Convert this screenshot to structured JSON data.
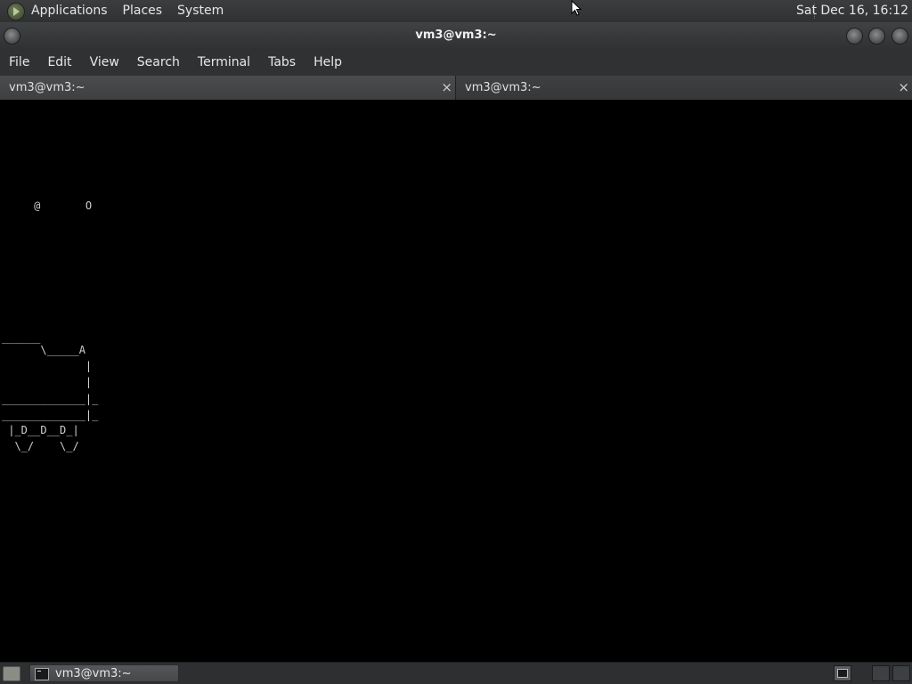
{
  "top_panel": {
    "menus": [
      "Applications",
      "Places",
      "System"
    ],
    "clock": "Sat Dec 16, 16:12"
  },
  "window": {
    "title": "vm3@vm3:~"
  },
  "menubar": {
    "items": [
      "File",
      "Edit",
      "View",
      "Search",
      "Terminal",
      "Tabs",
      "Help"
    ]
  },
  "tabs": [
    {
      "label": "vm3@vm3:~",
      "close": "×"
    },
    {
      "label": "vm3@vm3:~",
      "close": "×"
    }
  ],
  "terminal": {
    "lines": [
      "     @       O",
      "______",
      "      \\_____A",
      "             |",
      "             |",
      "_____________|_",
      "_____________|_",
      " |_D__D__D_|",
      "  \\_/    \\_/"
    ]
  },
  "taskbar": {
    "task_label": "vm3@vm3:~"
  },
  "icons": {
    "panel_logo": "applications-logo-icon",
    "terminal": "terminal-icon",
    "show_desktop": "show-desktop-icon"
  }
}
